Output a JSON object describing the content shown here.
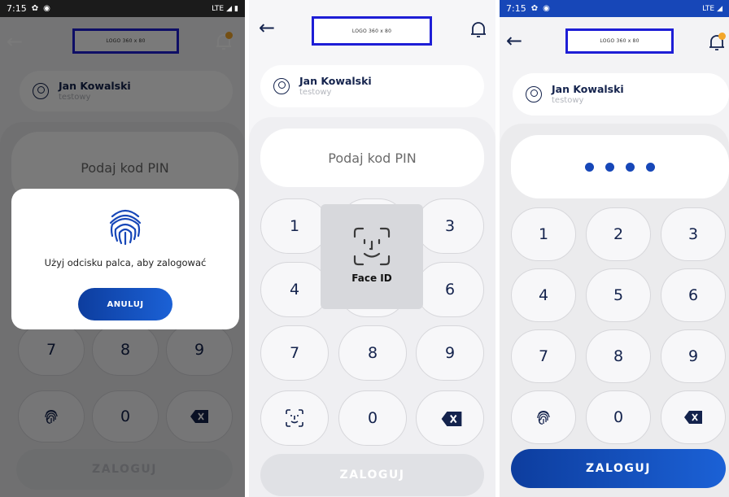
{
  "status_left": {
    "time": "7:15"
  },
  "status_right": {
    "network": "LTE"
  },
  "header": {
    "back_glyph": "←",
    "logo_text": "LOGO 360 x 80"
  },
  "user": {
    "name": "Jan Kowalski",
    "sub": "testowy"
  },
  "pin": {
    "placeholder": "Podaj kod PIN",
    "entered_dots": 4
  },
  "keypad": [
    "1",
    "2",
    "3",
    "4",
    "5",
    "6",
    "7",
    "8",
    "9",
    "0"
  ],
  "login_label": "ZALOGUJ",
  "fingerprint_dialog": {
    "message": "Użyj odcisku palca, aby zalogować",
    "cancel": "ANULUJ"
  },
  "faceid_overlay": {
    "caption": "Face ID"
  },
  "colors": {
    "navy": "#14234d",
    "accent": "#1747b8",
    "logo_border": "#1e1ed6",
    "badge": "#f3a62a"
  }
}
